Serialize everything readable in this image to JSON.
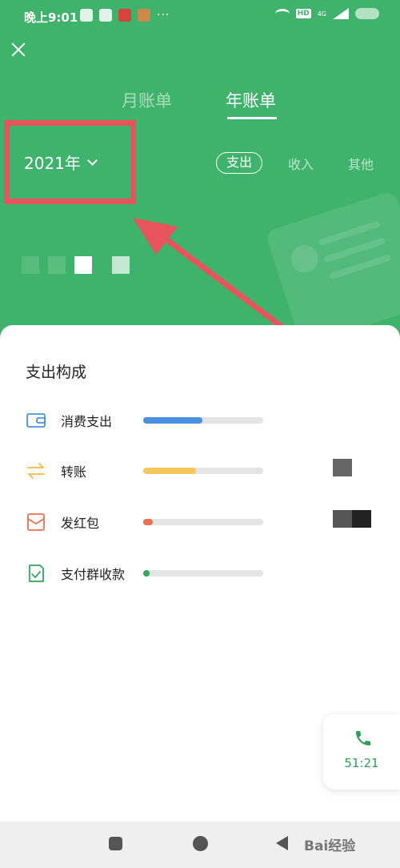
{
  "status_bar": {
    "time": "晚上9:01",
    "dots": "···",
    "network_badge": "HD",
    "network_type": "4G"
  },
  "tabs": [
    {
      "label": "月账单",
      "active": false
    },
    {
      "label": "年账单",
      "active": true
    }
  ],
  "year_selector": {
    "value": "2021年"
  },
  "filters": [
    {
      "label": "支出",
      "selected": true
    },
    {
      "label": "收入",
      "selected": false
    },
    {
      "label": "其他",
      "selected": false
    }
  ],
  "section": {
    "title": "支出构成",
    "items": [
      {
        "label": "消费支出",
        "icon": "wallet-icon",
        "color": "#4a90e2",
        "share": 0.49
      },
      {
        "label": "转账",
        "icon": "transfer-icon",
        "color": "#f5c65c",
        "share": 0.44
      },
      {
        "label": "发红包",
        "icon": "red-packet-icon",
        "color": "#ec6f4d",
        "share": 0.08
      },
      {
        "label": "支付群收款",
        "icon": "group-collection-icon",
        "color": "#2eaa5a",
        "share": 0.03
      }
    ]
  },
  "call_card": {
    "time": "51:21"
  },
  "watermark": "Bai经验",
  "colors": {
    "header_green": "#3fb36b",
    "highlight_red": "#e8545c",
    "call_green": "#2e9e57"
  }
}
